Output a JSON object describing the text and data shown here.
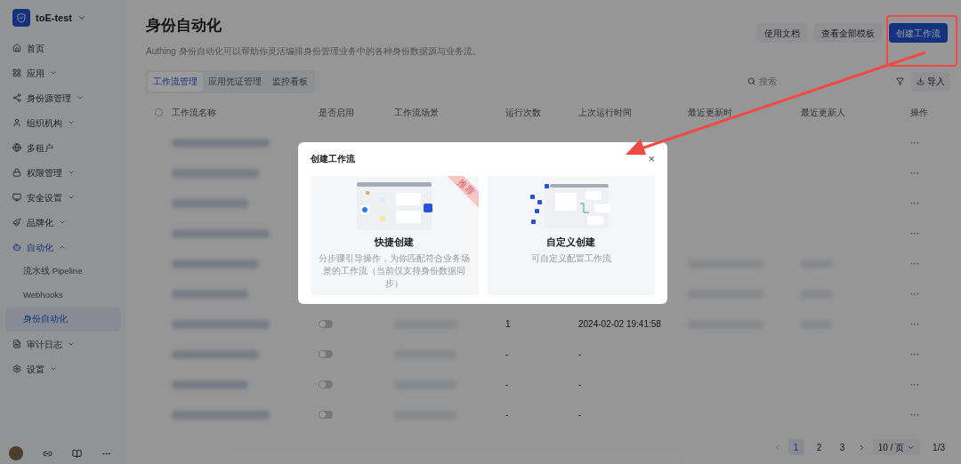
{
  "workspace": {
    "name": "toE-test"
  },
  "sidebar": {
    "items": [
      {
        "label": "首页",
        "kind": "link",
        "selected": false
      },
      {
        "label": "应用",
        "kind": "group",
        "selected": false,
        "expanded": false
      },
      {
        "label": "身份源管理",
        "kind": "group",
        "selected": false,
        "expanded": false
      },
      {
        "label": "组织机构",
        "kind": "group",
        "selected": false,
        "expanded": false
      },
      {
        "label": "多租户",
        "kind": "link",
        "selected": false
      },
      {
        "label": "权限管理",
        "kind": "group",
        "selected": false,
        "expanded": false
      },
      {
        "label": "安全设置",
        "kind": "group",
        "selected": false,
        "expanded": false
      },
      {
        "label": "品牌化",
        "kind": "group",
        "selected": false,
        "expanded": false
      },
      {
        "label": "自动化",
        "kind": "group",
        "selected": true,
        "expanded": true,
        "children": [
          {
            "label": "流水线 Pipeline",
            "selected": false
          },
          {
            "label": "Webhooks",
            "selected": false
          },
          {
            "label": "身份自动化",
            "selected": true
          }
        ]
      },
      {
        "label": "审计日志",
        "kind": "group",
        "selected": false,
        "expanded": false
      },
      {
        "label": "设置",
        "kind": "group",
        "selected": false,
        "expanded": false
      }
    ]
  },
  "page": {
    "title": "身份自动化",
    "description": "Authing 身份自动化可以帮助你灵活编排身份管理业务中的各种身份数据源与业务流。",
    "buttons": [
      {
        "label": "使用文档",
        "primary": false
      },
      {
        "label": "查看全部模板",
        "primary": false
      },
      {
        "label": "创建工作流",
        "primary": true
      }
    ]
  },
  "tabs": [
    {
      "label": "工作流管理",
      "selected": true
    },
    {
      "label": "应用凭证管理",
      "selected": false
    },
    {
      "label": "监控看板",
      "selected": false
    }
  ],
  "search": {
    "placeholder": "搜索"
  },
  "import_button": "导入",
  "table": {
    "select_all": {
      "checked": false
    },
    "columns": [
      "工作流名称",
      "是否启用",
      "工作流场景",
      "运行次数",
      "上次运行时间",
      "最近更新时",
      "最近更新人",
      "操作"
    ],
    "rows": [
      {
        "actions": "···"
      },
      {
        "actions": "···"
      },
      {
        "actions": "···"
      },
      {
        "actions": "···"
      },
      {
        "actions": "···"
      },
      {
        "actions": "···"
      },
      {
        "enabled": false,
        "runs": "1",
        "last_run": "2024-02-02 19:41:58",
        "actions": "···"
      },
      {
        "enabled": false,
        "runs": "-",
        "last_run": "-",
        "actions": "···"
      },
      {
        "enabled": false,
        "runs": "-",
        "last_run": "-",
        "actions": "···"
      },
      {
        "enabled": false,
        "runs": "-",
        "last_run": "-",
        "actions": "···"
      }
    ]
  },
  "pagination": {
    "pages": [
      {
        "label": "1",
        "selected": true
      },
      {
        "label": "2",
        "selected": false
      },
      {
        "label": "3",
        "selected": false
      }
    ],
    "page_size": "10 / 页",
    "summary": "1/3"
  },
  "dialog": {
    "title": "创建工作流",
    "close": "×",
    "options": [
      {
        "title": "快捷创建",
        "description": "分步骤引导操作，为你匹配符合业务场景的工作流（当前仅支持身份数据同步）",
        "badge": "推荐"
      },
      {
        "title": "自定义创建",
        "description": "可自定义配置工作流"
      }
    ]
  }
}
